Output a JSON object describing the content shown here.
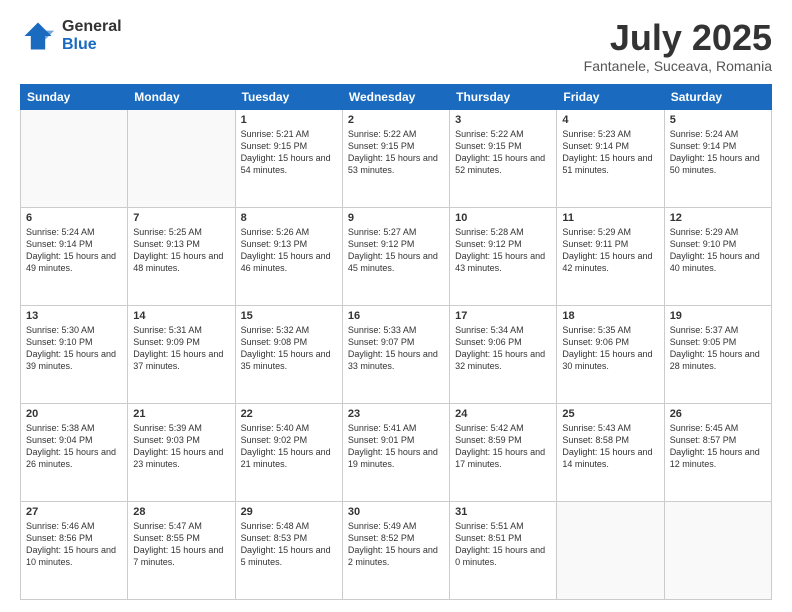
{
  "logo": {
    "general": "General",
    "blue": "Blue"
  },
  "header": {
    "month_year": "July 2025",
    "location": "Fantanele, Suceava, Romania"
  },
  "weekdays": [
    "Sunday",
    "Monday",
    "Tuesday",
    "Wednesday",
    "Thursday",
    "Friday",
    "Saturday"
  ],
  "weeks": [
    [
      {
        "day": "",
        "empty": true
      },
      {
        "day": "",
        "empty": true
      },
      {
        "day": "1",
        "sunrise": "5:21 AM",
        "sunset": "9:15 PM",
        "daylight": "15 hours and 54 minutes."
      },
      {
        "day": "2",
        "sunrise": "5:22 AM",
        "sunset": "9:15 PM",
        "daylight": "15 hours and 53 minutes."
      },
      {
        "day": "3",
        "sunrise": "5:22 AM",
        "sunset": "9:15 PM",
        "daylight": "15 hours and 52 minutes."
      },
      {
        "day": "4",
        "sunrise": "5:23 AM",
        "sunset": "9:14 PM",
        "daylight": "15 hours and 51 minutes."
      },
      {
        "day": "5",
        "sunrise": "5:24 AM",
        "sunset": "9:14 PM",
        "daylight": "15 hours and 50 minutes."
      }
    ],
    [
      {
        "day": "6",
        "sunrise": "5:24 AM",
        "sunset": "9:14 PM",
        "daylight": "15 hours and 49 minutes."
      },
      {
        "day": "7",
        "sunrise": "5:25 AM",
        "sunset": "9:13 PM",
        "daylight": "15 hours and 48 minutes."
      },
      {
        "day": "8",
        "sunrise": "5:26 AM",
        "sunset": "9:13 PM",
        "daylight": "15 hours and 46 minutes."
      },
      {
        "day": "9",
        "sunrise": "5:27 AM",
        "sunset": "9:12 PM",
        "daylight": "15 hours and 45 minutes."
      },
      {
        "day": "10",
        "sunrise": "5:28 AM",
        "sunset": "9:12 PM",
        "daylight": "15 hours and 43 minutes."
      },
      {
        "day": "11",
        "sunrise": "5:29 AM",
        "sunset": "9:11 PM",
        "daylight": "15 hours and 42 minutes."
      },
      {
        "day": "12",
        "sunrise": "5:29 AM",
        "sunset": "9:10 PM",
        "daylight": "15 hours and 40 minutes."
      }
    ],
    [
      {
        "day": "13",
        "sunrise": "5:30 AM",
        "sunset": "9:10 PM",
        "daylight": "15 hours and 39 minutes."
      },
      {
        "day": "14",
        "sunrise": "5:31 AM",
        "sunset": "9:09 PM",
        "daylight": "15 hours and 37 minutes."
      },
      {
        "day": "15",
        "sunrise": "5:32 AM",
        "sunset": "9:08 PM",
        "daylight": "15 hours and 35 minutes."
      },
      {
        "day": "16",
        "sunrise": "5:33 AM",
        "sunset": "9:07 PM",
        "daylight": "15 hours and 33 minutes."
      },
      {
        "day": "17",
        "sunrise": "5:34 AM",
        "sunset": "9:06 PM",
        "daylight": "15 hours and 32 minutes."
      },
      {
        "day": "18",
        "sunrise": "5:35 AM",
        "sunset": "9:06 PM",
        "daylight": "15 hours and 30 minutes."
      },
      {
        "day": "19",
        "sunrise": "5:37 AM",
        "sunset": "9:05 PM",
        "daylight": "15 hours and 28 minutes."
      }
    ],
    [
      {
        "day": "20",
        "sunrise": "5:38 AM",
        "sunset": "9:04 PM",
        "daylight": "15 hours and 26 minutes."
      },
      {
        "day": "21",
        "sunrise": "5:39 AM",
        "sunset": "9:03 PM",
        "daylight": "15 hours and 23 minutes."
      },
      {
        "day": "22",
        "sunrise": "5:40 AM",
        "sunset": "9:02 PM",
        "daylight": "15 hours and 21 minutes."
      },
      {
        "day": "23",
        "sunrise": "5:41 AM",
        "sunset": "9:01 PM",
        "daylight": "15 hours and 19 minutes."
      },
      {
        "day": "24",
        "sunrise": "5:42 AM",
        "sunset": "8:59 PM",
        "daylight": "15 hours and 17 minutes."
      },
      {
        "day": "25",
        "sunrise": "5:43 AM",
        "sunset": "8:58 PM",
        "daylight": "15 hours and 14 minutes."
      },
      {
        "day": "26",
        "sunrise": "5:45 AM",
        "sunset": "8:57 PM",
        "daylight": "15 hours and 12 minutes."
      }
    ],
    [
      {
        "day": "27",
        "sunrise": "5:46 AM",
        "sunset": "8:56 PM",
        "daylight": "15 hours and 10 minutes."
      },
      {
        "day": "28",
        "sunrise": "5:47 AM",
        "sunset": "8:55 PM",
        "daylight": "15 hours and 7 minutes."
      },
      {
        "day": "29",
        "sunrise": "5:48 AM",
        "sunset": "8:53 PM",
        "daylight": "15 hours and 5 minutes."
      },
      {
        "day": "30",
        "sunrise": "5:49 AM",
        "sunset": "8:52 PM",
        "daylight": "15 hours and 2 minutes."
      },
      {
        "day": "31",
        "sunrise": "5:51 AM",
        "sunset": "8:51 PM",
        "daylight": "15 hours and 0 minutes."
      },
      {
        "day": "",
        "empty": true
      },
      {
        "day": "",
        "empty": true
      }
    ]
  ]
}
